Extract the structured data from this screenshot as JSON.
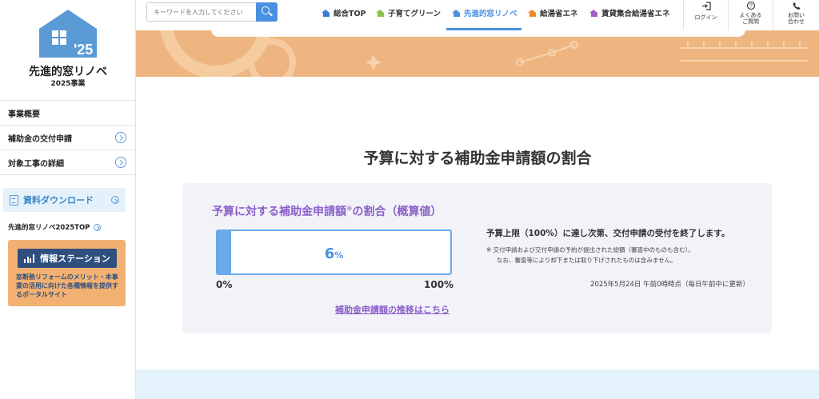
{
  "sidebar": {
    "logo_year": "'25",
    "logo_title": "先進的窓リノベ",
    "logo_subtitle": "2025事業",
    "items": [
      {
        "label": "事業概要"
      },
      {
        "label": "補助金の交付申請"
      },
      {
        "label": "対象工事の詳細"
      }
    ],
    "download_label": "資料ダウンロード",
    "top_link": "先進的窓リノベ2025TOP",
    "info_station": {
      "button_label": "情報ステーション",
      "description": "窓断熱リフォームのメリット・本事業の活用に向けた各種情報を提供するポータルサイト"
    }
  },
  "header": {
    "search_placeholder": "キーワードを入力してください",
    "nav": [
      {
        "label": "総合TOP",
        "color": "#3a7bd5"
      },
      {
        "label": "子育てグリーン",
        "color": "#8bc34a"
      },
      {
        "label": "先進的窓リノベ",
        "color": "#4a90e2",
        "active": true
      },
      {
        "label": "給湯省エネ",
        "color": "#f08a24"
      },
      {
        "label": "賃貸集合給湯省エネ",
        "color": "#a65fc9"
      }
    ],
    "utility": [
      {
        "label": "ログイン"
      },
      {
        "label": "よくある\nご質問"
      },
      {
        "label": "お問い\n合わせ"
      }
    ]
  },
  "main": {
    "title": "予算に対する補助金申請額の割合",
    "panel_title": "予算に対する補助金申請額",
    "panel_title_mark": "※",
    "panel_title_suffix": "の割合（概算値）",
    "progress": {
      "value": 6,
      "unit": "%",
      "min_label": "0%",
      "max_label": "100%"
    },
    "trend_link": "補助金申請額の推移はこちら",
    "notice": "予算上限（100%）に達し次第、交付申請の受付を終了します。",
    "note_line1": "※ 交付申請および交付申請の予約が提出された総額（審査中のものも含む）。",
    "note_line2": "なお、審査等により却下または取り下げされたものは含みません。",
    "updated": "2025年5月24日 午前0時時点（毎日午前中に更新）"
  },
  "colors": {
    "accent_blue": "#4a90e2",
    "accent_purple": "#8b5fc9",
    "banner_orange": "#efb580",
    "info_card_orange": "#f2b172"
  }
}
